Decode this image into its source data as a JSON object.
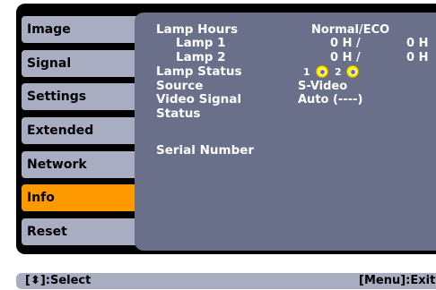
{
  "menu": {
    "tabs": [
      {
        "label": "Image",
        "active": false
      },
      {
        "label": "Signal",
        "active": false
      },
      {
        "label": "Settings",
        "active": false
      },
      {
        "label": "Extended",
        "active": false
      },
      {
        "label": "Network",
        "active": false
      },
      {
        "label": "Info",
        "active": true
      },
      {
        "label": "Reset",
        "active": false
      }
    ]
  },
  "info": {
    "lamp_hours_label": "Lamp Hours",
    "lamp_hours_header": "Normal/ECO",
    "lamp1_label": "Lamp 1",
    "lamp1_normal": "0 H /",
    "lamp1_eco": "0 H",
    "lamp2_label": "Lamp 2",
    "lamp2_normal": "0 H /",
    "lamp2_eco": "0 H",
    "lamp_status_label": "Lamp Status",
    "lamp_status_1": "1",
    "lamp_status_2": "2",
    "source_label": "Source",
    "source_value": "S-Video",
    "video_signal_label": "Video Signal",
    "video_signal_value": "Auto (----)",
    "status_label": "Status",
    "serial_label": "Serial Number"
  },
  "statusbar": {
    "select_hint": "[⬍]:Select",
    "exit_hint": "[Menu]:Exit"
  },
  "colors": {
    "tab_bg": "#a9adc2",
    "tab_active": "#ff9900",
    "panel_bg": "#6a6f8a",
    "frame_bg": "#000000",
    "lamp_indicator": "#fff200"
  }
}
